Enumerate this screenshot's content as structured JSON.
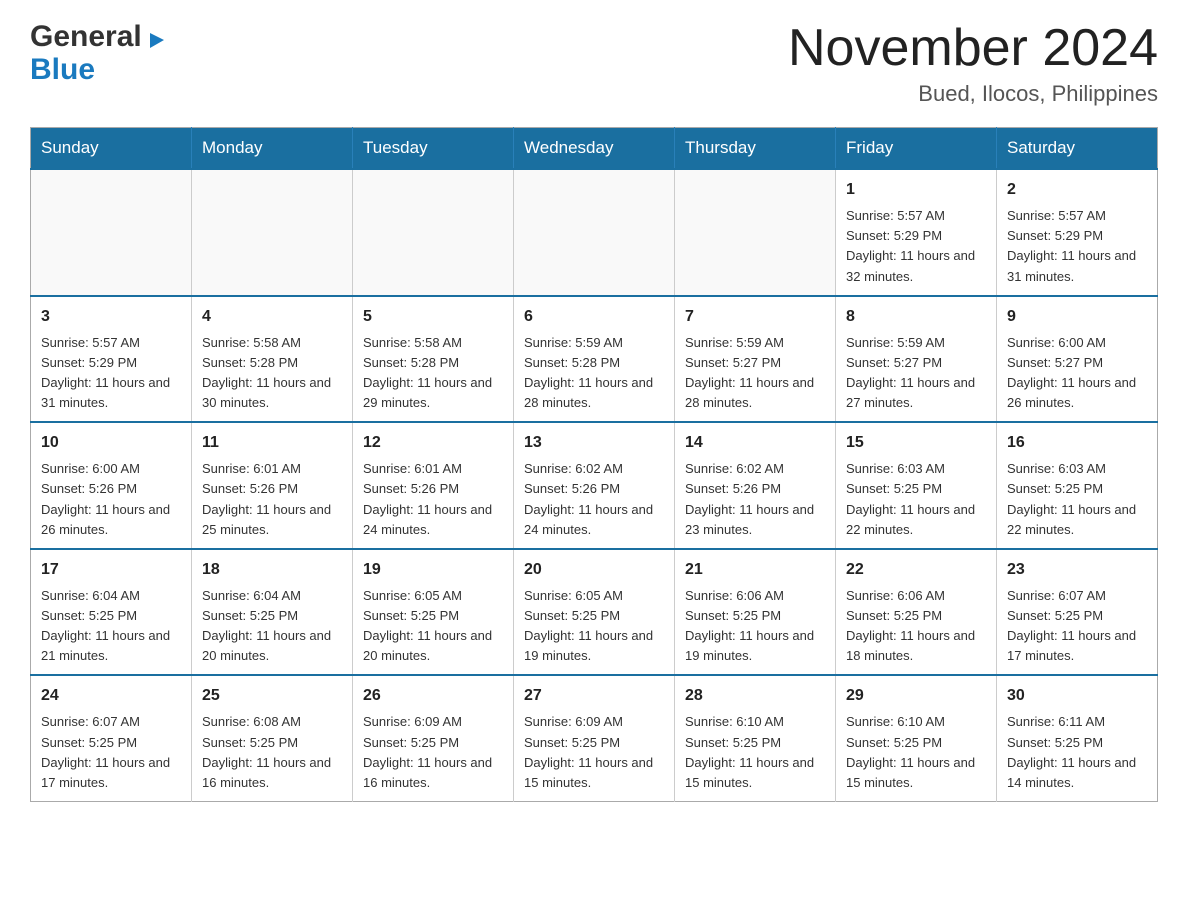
{
  "header": {
    "logo_general": "General",
    "logo_blue": "Blue",
    "month_year": "November 2024",
    "location": "Bued, Ilocos, Philippines"
  },
  "calendar": {
    "days_of_week": [
      "Sunday",
      "Monday",
      "Tuesday",
      "Wednesday",
      "Thursday",
      "Friday",
      "Saturday"
    ],
    "weeks": [
      [
        {
          "day": "",
          "info": ""
        },
        {
          "day": "",
          "info": ""
        },
        {
          "day": "",
          "info": ""
        },
        {
          "day": "",
          "info": ""
        },
        {
          "day": "",
          "info": ""
        },
        {
          "day": "1",
          "info": "Sunrise: 5:57 AM\nSunset: 5:29 PM\nDaylight: 11 hours and 32 minutes."
        },
        {
          "day": "2",
          "info": "Sunrise: 5:57 AM\nSunset: 5:29 PM\nDaylight: 11 hours and 31 minutes."
        }
      ],
      [
        {
          "day": "3",
          "info": "Sunrise: 5:57 AM\nSunset: 5:29 PM\nDaylight: 11 hours and 31 minutes."
        },
        {
          "day": "4",
          "info": "Sunrise: 5:58 AM\nSunset: 5:28 PM\nDaylight: 11 hours and 30 minutes."
        },
        {
          "day": "5",
          "info": "Sunrise: 5:58 AM\nSunset: 5:28 PM\nDaylight: 11 hours and 29 minutes."
        },
        {
          "day": "6",
          "info": "Sunrise: 5:59 AM\nSunset: 5:28 PM\nDaylight: 11 hours and 28 minutes."
        },
        {
          "day": "7",
          "info": "Sunrise: 5:59 AM\nSunset: 5:27 PM\nDaylight: 11 hours and 28 minutes."
        },
        {
          "day": "8",
          "info": "Sunrise: 5:59 AM\nSunset: 5:27 PM\nDaylight: 11 hours and 27 minutes."
        },
        {
          "day": "9",
          "info": "Sunrise: 6:00 AM\nSunset: 5:27 PM\nDaylight: 11 hours and 26 minutes."
        }
      ],
      [
        {
          "day": "10",
          "info": "Sunrise: 6:00 AM\nSunset: 5:26 PM\nDaylight: 11 hours and 26 minutes."
        },
        {
          "day": "11",
          "info": "Sunrise: 6:01 AM\nSunset: 5:26 PM\nDaylight: 11 hours and 25 minutes."
        },
        {
          "day": "12",
          "info": "Sunrise: 6:01 AM\nSunset: 5:26 PM\nDaylight: 11 hours and 24 minutes."
        },
        {
          "day": "13",
          "info": "Sunrise: 6:02 AM\nSunset: 5:26 PM\nDaylight: 11 hours and 24 minutes."
        },
        {
          "day": "14",
          "info": "Sunrise: 6:02 AM\nSunset: 5:26 PM\nDaylight: 11 hours and 23 minutes."
        },
        {
          "day": "15",
          "info": "Sunrise: 6:03 AM\nSunset: 5:25 PM\nDaylight: 11 hours and 22 minutes."
        },
        {
          "day": "16",
          "info": "Sunrise: 6:03 AM\nSunset: 5:25 PM\nDaylight: 11 hours and 22 minutes."
        }
      ],
      [
        {
          "day": "17",
          "info": "Sunrise: 6:04 AM\nSunset: 5:25 PM\nDaylight: 11 hours and 21 minutes."
        },
        {
          "day": "18",
          "info": "Sunrise: 6:04 AM\nSunset: 5:25 PM\nDaylight: 11 hours and 20 minutes."
        },
        {
          "day": "19",
          "info": "Sunrise: 6:05 AM\nSunset: 5:25 PM\nDaylight: 11 hours and 20 minutes."
        },
        {
          "day": "20",
          "info": "Sunrise: 6:05 AM\nSunset: 5:25 PM\nDaylight: 11 hours and 19 minutes."
        },
        {
          "day": "21",
          "info": "Sunrise: 6:06 AM\nSunset: 5:25 PM\nDaylight: 11 hours and 19 minutes."
        },
        {
          "day": "22",
          "info": "Sunrise: 6:06 AM\nSunset: 5:25 PM\nDaylight: 11 hours and 18 minutes."
        },
        {
          "day": "23",
          "info": "Sunrise: 6:07 AM\nSunset: 5:25 PM\nDaylight: 11 hours and 17 minutes."
        }
      ],
      [
        {
          "day": "24",
          "info": "Sunrise: 6:07 AM\nSunset: 5:25 PM\nDaylight: 11 hours and 17 minutes."
        },
        {
          "day": "25",
          "info": "Sunrise: 6:08 AM\nSunset: 5:25 PM\nDaylight: 11 hours and 16 minutes."
        },
        {
          "day": "26",
          "info": "Sunrise: 6:09 AM\nSunset: 5:25 PM\nDaylight: 11 hours and 16 minutes."
        },
        {
          "day": "27",
          "info": "Sunrise: 6:09 AM\nSunset: 5:25 PM\nDaylight: 11 hours and 15 minutes."
        },
        {
          "day": "28",
          "info": "Sunrise: 6:10 AM\nSunset: 5:25 PM\nDaylight: 11 hours and 15 minutes."
        },
        {
          "day": "29",
          "info": "Sunrise: 6:10 AM\nSunset: 5:25 PM\nDaylight: 11 hours and 15 minutes."
        },
        {
          "day": "30",
          "info": "Sunrise: 6:11 AM\nSunset: 5:25 PM\nDaylight: 11 hours and 14 minutes."
        }
      ]
    ]
  }
}
